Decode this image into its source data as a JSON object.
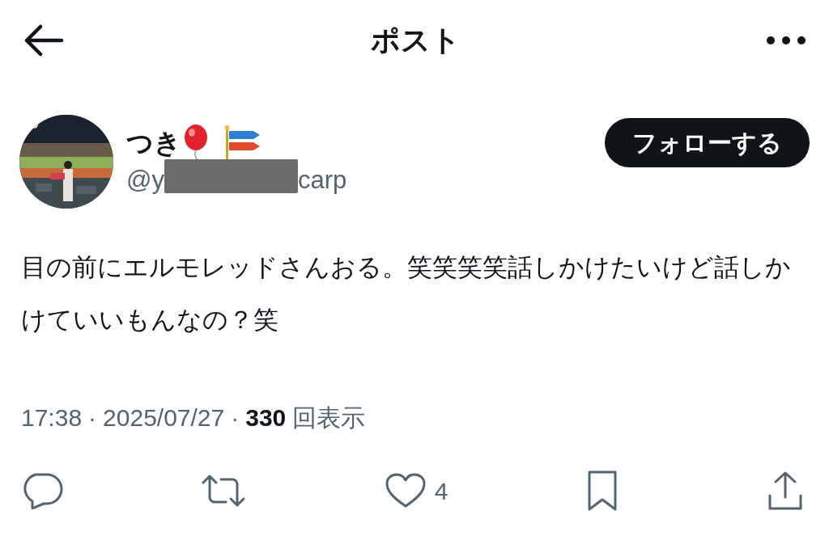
{
  "header": {
    "title": "ポスト"
  },
  "author": {
    "name": "つき",
    "handle_start": "@y",
    "handle_end": "carp",
    "handle_redacted": true,
    "follow_button": "フォローする"
  },
  "post": {
    "text": "目の前にエルモレッドさんおる。笑笑笑笑話しかけたいけど話しかけていいもんなの？笑"
  },
  "meta": {
    "time": "17:38",
    "separator_1": "·",
    "date": "2025/07/27",
    "separator_2": "·",
    "views": "330",
    "views_label": "回表示"
  },
  "actions": [
    {
      "kind": "reply"
    },
    {
      "kind": "repost"
    },
    {
      "kind": "like",
      "count": "4"
    },
    {
      "kind": "bookmark"
    },
    {
      "kind": "share"
    }
  ]
}
